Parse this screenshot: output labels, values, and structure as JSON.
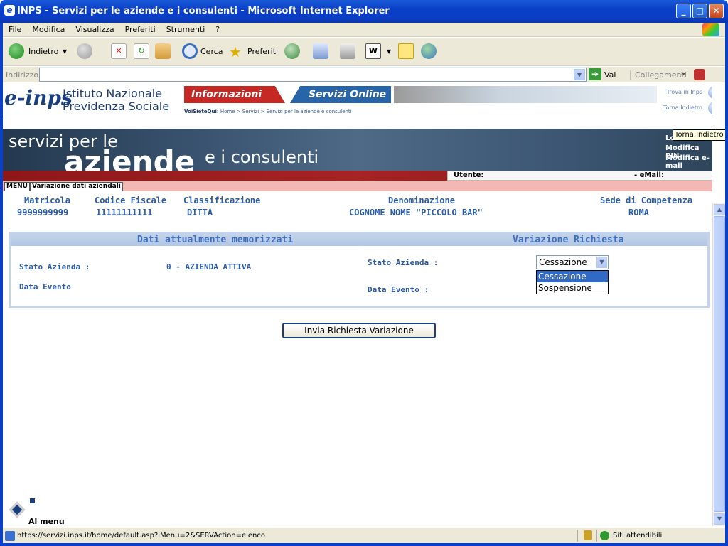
{
  "window": {
    "title": "INPS - Servizi per le aziende e i consulenti - Microsoft Internet Explorer"
  },
  "menubar": {
    "items": [
      "File",
      "Modifica",
      "Visualizza",
      "Preferiti",
      "Strumenti",
      "?"
    ]
  },
  "toolbar": {
    "back": "Indietro",
    "search": "Cerca",
    "favorites": "Preferiti"
  },
  "addressbar": {
    "label": "Indirizzo",
    "url": "",
    "go": "Vai",
    "links": "Collegamenti"
  },
  "header": {
    "logo": "e-inps",
    "institute_line1": "Istituto Nazionale",
    "institute_line2": "Previdenza Sociale",
    "tab_info": "Informazioni",
    "tab_services": "Servizi Online",
    "breadcrumb_label": "VoiSieteQui:",
    "breadcrumb": "Home > Servizi > Servizi per le aziende e consulenti",
    "find_link": "Trova in Inps",
    "back_link": "Torna Indietro"
  },
  "banner": {
    "line1": "servizi per le",
    "line2": "aziende",
    "line3": "e i consulenti",
    "logout": "Logout",
    "modify_pin": "Modifica PIN",
    "modify_email": "Modifica e-mail",
    "utente_label": "Utente:",
    "email_label": "- eMail:",
    "tabs": [
      "MENU",
      "Variazione dati aziendali"
    ],
    "tooltip": "Torna Indietro"
  },
  "company": {
    "headers": [
      "Matricola",
      "Codice Fiscale",
      "Classificazione",
      "Denominazione",
      "Sede di Competenza"
    ],
    "values": [
      "9999999999",
      "11111111111",
      "DITTA",
      "COGNOME NOME \"PICCOLO BAR\"",
      "ROMA"
    ]
  },
  "panel": {
    "left_title": "Dati attualmente memorizzati",
    "right_title": "Variazione Richiesta",
    "stato_label": "Stato Azienda :",
    "stato_value": "0 - AZIENDA ATTIVA",
    "data_label": "Data Evento",
    "stato_req_label": "Stato Azienda :",
    "data_req_label": "Data Evento :",
    "select_value": "Cessazione",
    "options": [
      "Cessazione",
      "Sospensione"
    ]
  },
  "actions": {
    "submit": "Invia Richiesta Variazione",
    "home": "Al menu principale"
  },
  "statusbar": {
    "url": "https://servizi.inps.it/home/default.asp?iMenu=2&SERVAction=elenco",
    "zone": "Siti attendibili"
  }
}
